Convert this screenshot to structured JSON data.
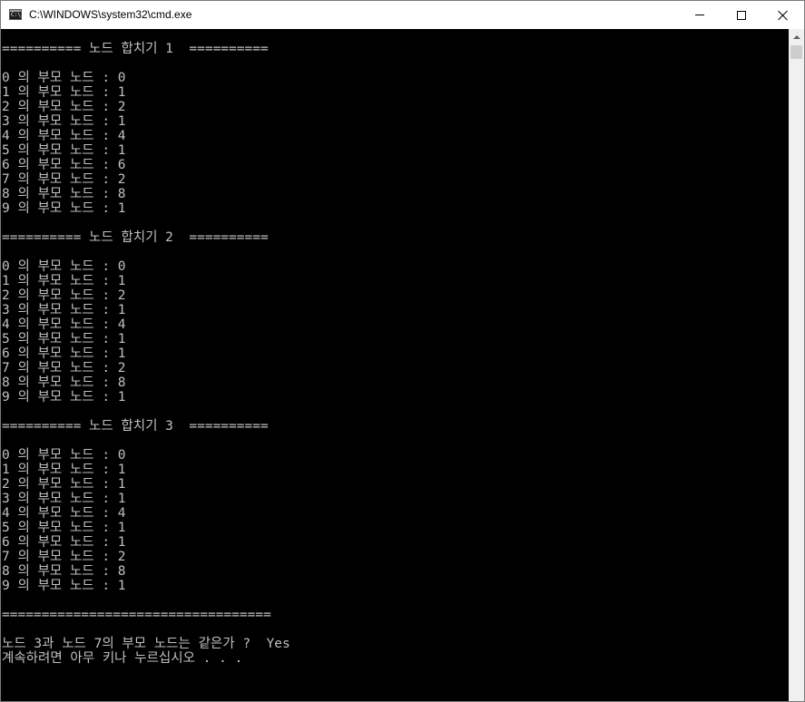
{
  "window": {
    "title": "C:\\WINDOWS\\system32\\cmd.exe",
    "icon": "cmd-icon"
  },
  "caption_buttons": {
    "minimize": "minimize-icon",
    "maximize": "maximize-icon",
    "close": "close-icon"
  },
  "console": {
    "background": "#000000",
    "foreground": "#c0c0c0",
    "lines": [
      "========== 노드 합치기 1  ==========",
      "",
      "0 의 부모 노드 : 0",
      "1 의 부모 노드 : 1",
      "2 의 부모 노드 : 2",
      "3 의 부모 노드 : 1",
      "4 의 부모 노드 : 4",
      "5 의 부모 노드 : 1",
      "6 의 부모 노드 : 6",
      "7 의 부모 노드 : 2",
      "8 의 부모 노드 : 8",
      "9 의 부모 노드 : 1",
      "",
      "========== 노드 합치기 2  ==========",
      "",
      "0 의 부모 노드 : 0",
      "1 의 부모 노드 : 1",
      "2 의 부모 노드 : 2",
      "3 의 부모 노드 : 1",
      "4 의 부모 노드 : 4",
      "5 의 부모 노드 : 1",
      "6 의 부모 노드 : 1",
      "7 의 부모 노드 : 2",
      "8 의 부모 노드 : 8",
      "9 의 부모 노드 : 1",
      "",
      "========== 노드 합치기 3  ==========",
      "",
      "0 의 부모 노드 : 0",
      "1 의 부모 노드 : 1",
      "2 의 부모 노드 : 1",
      "3 의 부모 노드 : 1",
      "4 의 부모 노드 : 4",
      "5 의 부모 노드 : 1",
      "6 의 부모 노드 : 1",
      "7 의 부모 노드 : 2",
      "8 의 부모 노드 : 8",
      "9 의 부모 노드 : 1",
      "",
      "==================================",
      "",
      "노드 3과 노드 7의 부모 노드는 같은가 ?  Yes",
      "계속하려면 아무 키나 누르십시오 . . ."
    ]
  }
}
